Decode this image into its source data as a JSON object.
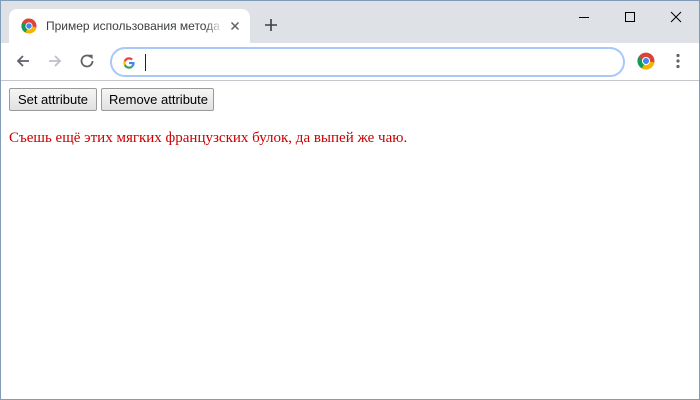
{
  "tab": {
    "title": "Пример использования метода setAttribute()",
    "favicon": "chrome-logo-icon",
    "close_icon": "close-icon"
  },
  "new_tab_icon": "plus-icon",
  "window_controls": [
    "minimize-icon",
    "maximize-icon",
    "close-icon"
  ],
  "toolbar": {
    "back_icon": "back-arrow-icon",
    "forward_icon": "forward-arrow-icon",
    "reload_icon": "reload-icon",
    "search_engine_icon": "google-g-icon",
    "address_value": "",
    "extension_icon": "chrome-logo-icon",
    "menu_icon": "kebab-menu-icon"
  },
  "page": {
    "set_button_label": "Set attribute",
    "remove_button_label": "Remove attribute",
    "paragraph_text": "Съешь ещё этих мягких французских булок, да выпей же чаю.",
    "paragraph_color": "#cc0000"
  },
  "colors": {
    "tab_strip": "#dee1e6",
    "omnibox_focus_ring": "#a8c7fa",
    "window_border": "#7f9db9"
  }
}
